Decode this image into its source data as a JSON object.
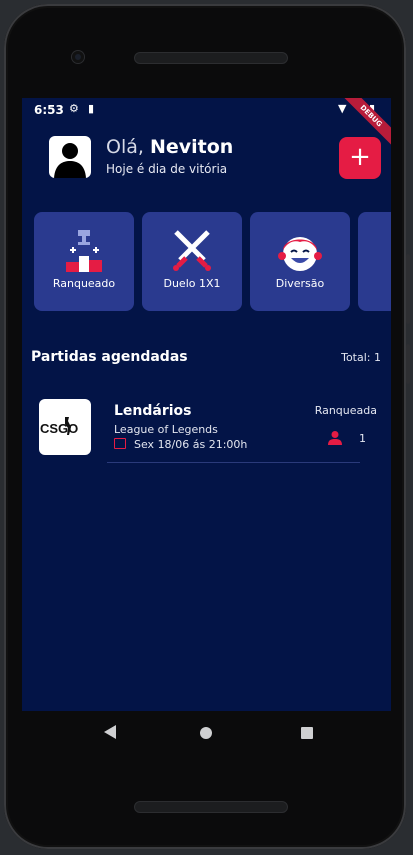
{
  "status_bar": {
    "time": "6:53",
    "debug_label": "DEBUG"
  },
  "header": {
    "greeting_prefix": "Olá,",
    "user_name": "Neviton",
    "subtitle": "Hoje é dia de vitória",
    "add_button_label": "+"
  },
  "categories": [
    {
      "label": "Ranqueado",
      "icon": "podium-icon"
    },
    {
      "label": "Duelo 1X1",
      "icon": "crossed-swords-icon"
    },
    {
      "label": "Diversão",
      "icon": "laughing-face-icon"
    },
    {
      "label": "",
      "icon": ""
    }
  ],
  "section": {
    "title": "Partidas agendadas",
    "total": "Total: 1"
  },
  "matches": [
    {
      "logo_text": "CSGO",
      "title": "Lendários",
      "game": "League of Legends",
      "date": "Sex 18/06 ás 21:00h",
      "type": "Ranqueada",
      "players": "1"
    }
  ],
  "colors": {
    "background": "#031447",
    "card": "#2a3a8f",
    "accent": "#e51c44"
  }
}
